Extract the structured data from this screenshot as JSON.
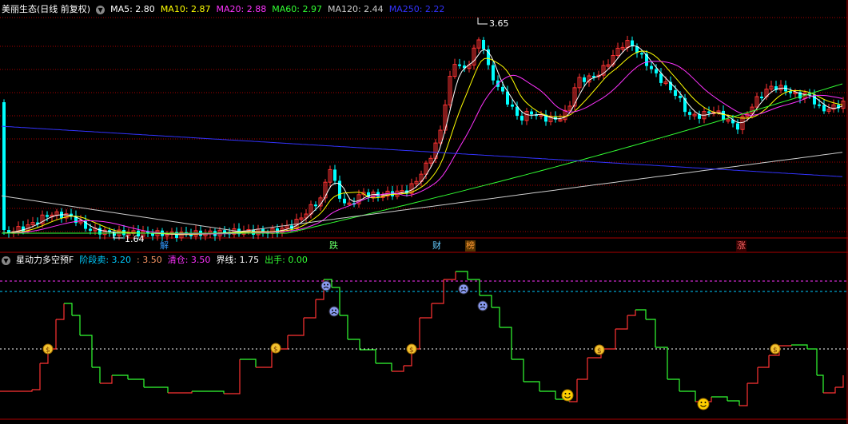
{
  "main_panel": {
    "stock_name": "美丽生态",
    "period": "(日线 前复权)",
    "indicators": [
      {
        "label": "MA5: 2.80",
        "color": "#ffffff"
      },
      {
        "label": "MA10: 2.87",
        "color": "#ffff00"
      },
      {
        "label": "MA20: 2.88",
        "color": "#ff33ff"
      },
      {
        "label": "MA60: 2.97",
        "color": "#33ff33"
      },
      {
        "label": "MA120: 2.44",
        "color": "#cccccc"
      },
      {
        "label": "MA250: 2.22",
        "color": "#3333ff"
      }
    ],
    "high_label": "3.65",
    "low_label": "1.64",
    "event_tags": [
      {
        "text": "解",
        "color": "#3399ff"
      },
      {
        "text": "跌",
        "color": "#66ff66"
      },
      {
        "text": "财",
        "color": "#66ccff"
      },
      {
        "text": "榜",
        "color": "#ff9933"
      },
      {
        "text": "涨",
        "color": "#ff6666"
      }
    ]
  },
  "sub_panel": {
    "name": "星动力多空预F",
    "indicators": [
      {
        "label": "阶段卖: 3.20",
        "color": "#00ccff"
      },
      {
        "label": ": 3.50",
        "color": "#ff9966"
      },
      {
        "label": "清仓: 3.50",
        "color": "#ff33ff"
      },
      {
        "label": "界线: 1.75",
        "color": "#ffffff"
      },
      {
        "label": "出手: 0.00",
        "color": "#33ff33"
      }
    ]
  },
  "colors": {
    "up": "#ff3333",
    "down": "#00ffff",
    "grid": "#aa0000",
    "step_up": "#ff3333",
    "step_down": "#33ff33"
  }
}
